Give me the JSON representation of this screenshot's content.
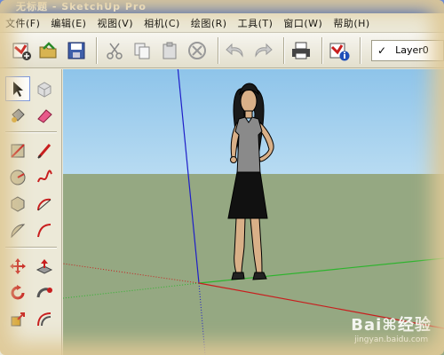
{
  "window": {
    "title": "无标题 - SketchUp Pro"
  },
  "menu": [
    "文件(F)",
    "编辑(E)",
    "视图(V)",
    "相机(C)",
    "绘图(R)",
    "工具(T)",
    "窗口(W)",
    "帮助(H)"
  ],
  "toolbar": {
    "buttons": [
      "new-icon",
      "open-icon",
      "save-icon",
      "cut-icon",
      "copy-icon",
      "paste-icon",
      "erase-icon",
      "undo-icon",
      "redo-icon",
      "print-icon",
      "model-info-icon"
    ],
    "layer": {
      "name": "Layer0",
      "checked": "✓"
    }
  },
  "palette": {
    "tools": [
      "select-icon",
      "component-icon",
      "paint-bucket-icon",
      "eraser-icon",
      "rectangle-icon",
      "line-icon",
      "circle-icon",
      "arc-icon",
      "polygon-icon",
      "freehand-icon",
      "push-pull-icon",
      "follow-me-icon",
      "move-icon",
      "offset-icon",
      "rotate-icon",
      "scale-icon",
      "tape-icon",
      "orbit-icon"
    ]
  },
  "colors": {
    "sky": "#8ec4ea",
    "ground": "#95a882",
    "axis_red": "#c81e1e",
    "axis_green": "#2db42d",
    "axis_blue": "#1e1ec8"
  },
  "watermark": {
    "logo": "Bai⌘经验",
    "url": "jingyan.baidu.com"
  }
}
